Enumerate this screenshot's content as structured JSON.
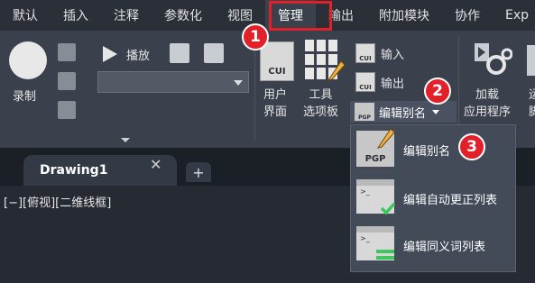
{
  "tabs": [
    "默认",
    "插入",
    "注释",
    "参数化",
    "视图",
    "管理",
    "输出",
    "附加模块",
    "协作",
    "Exp"
  ],
  "active_tab_index": 5,
  "ribbon": {
    "record_label": "录制",
    "play_label": "播放",
    "cui_text": "CUI",
    "user_interface_label_line1": "用户",
    "user_interface_label_line2": "界面",
    "tool_palettes_label_line1": "工具",
    "tool_palettes_label_line2": "选项板",
    "import_label": "输入",
    "export_label": "输出",
    "edit_aliases_label": "编辑别名",
    "load_app_label_line1": "加载",
    "load_app_label_line2": "应用程序",
    "cut_label_line1": "运",
    "cut_label_line2": "脚"
  },
  "steps": [
    "1",
    "2",
    "3"
  ],
  "doc_tab": {
    "title": "Drawing1",
    "close": "✕",
    "new": "+"
  },
  "viewport_label": "[−][俯视][二维线框]",
  "menu": {
    "items": [
      {
        "label": "编辑别名",
        "icon_text": "PGP"
      },
      {
        "label": "编辑自动更正列表",
        "icon_text": ">_"
      },
      {
        "label": "编辑同义词列表",
        "icon_text": ">_"
      }
    ]
  },
  "colors": {
    "highlight_red": "#e1202a",
    "ribbon_bg": "#3a404c",
    "tab_bar_bg": "#2a2f38"
  }
}
